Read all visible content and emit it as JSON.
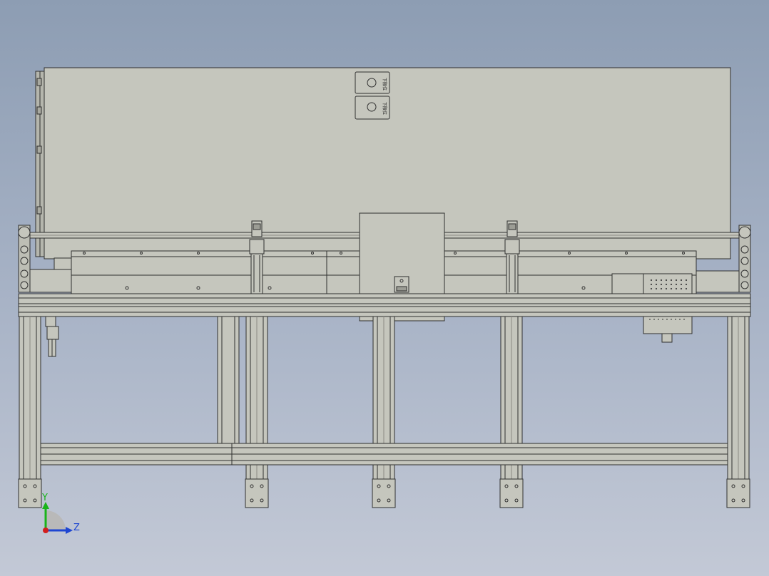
{
  "viewport": {
    "background_top": "#8d9db3",
    "background_bottom": "#c3c9d6",
    "part_fill": "#c5c6bd",
    "edge_color": "#303030"
  },
  "triad": {
    "y_label": "Y",
    "z_label": "Z",
    "y_color": "#19b419",
    "z_color": "#1e46d2",
    "x_color": "#d21e1e"
  },
  "panel_labels": {
    "text": "下限位"
  }
}
